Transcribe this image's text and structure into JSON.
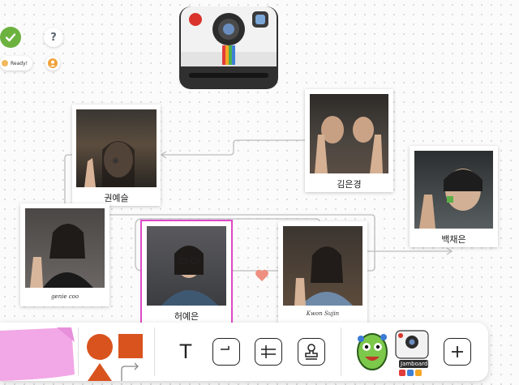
{
  "status": {
    "help_label": "?",
    "ready_label": "Ready!"
  },
  "photos": [
    {
      "id": "p1",
      "caption": "권예슬",
      "script": false
    },
    {
      "id": "p2",
      "caption": "김은경",
      "script": false
    },
    {
      "id": "p3",
      "caption": "백채은",
      "script": false
    },
    {
      "id": "p4",
      "caption": "genie coo",
      "script": true
    },
    {
      "id": "p5",
      "caption": "허예은",
      "script": false
    },
    {
      "id": "p6",
      "caption": "Kwon Sujin",
      "script": true
    }
  ],
  "toolbar": {
    "text_tool": "T",
    "sticker_label": "Jamboard"
  },
  "colors": {
    "accent_selected": "#e049c9",
    "shape_orange": "#d9531e",
    "sticky_pink": "#f2a7e6",
    "heart": "#ef8f7f"
  }
}
